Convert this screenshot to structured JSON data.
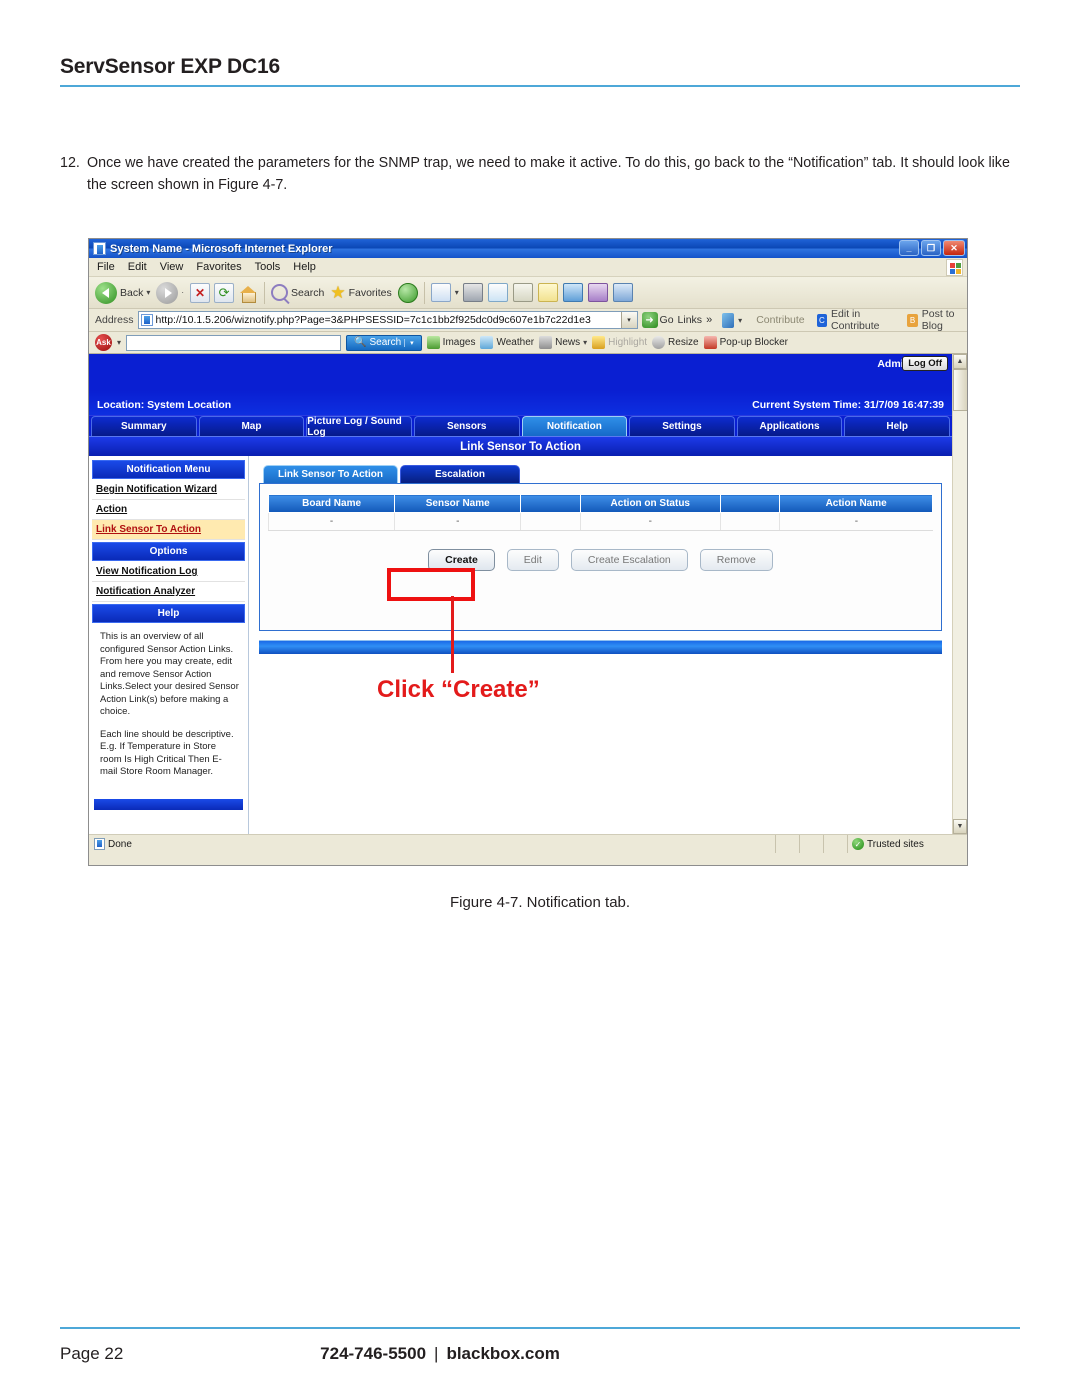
{
  "page": {
    "header_title": "ServSensor EXP DC16",
    "step_number": "12.",
    "step_text": "Once we have created the parameters for the SNMP trap, we need to make it active. To do this, go back to the “Notification” tab. It should look like the screen shown in  Figure 4-7.",
    "figure_caption": "Figure 4-7. Notification tab.",
    "page_number": "Page 22",
    "phone": "724-746-5500",
    "separator": "|",
    "website": "blackbox.com",
    "accent_color": "#4da8d8"
  },
  "browser": {
    "title": "System Name - Microsoft Internet Explorer",
    "window_buttons": {
      "minimize": "_",
      "maximize": "❐",
      "close": "✕"
    },
    "menu": [
      "File",
      "Edit",
      "View",
      "Favorites",
      "Tools",
      "Help"
    ],
    "toolbar": {
      "back_label": "Back",
      "back_caret": "▾",
      "search_label": "Search",
      "favorites_label": "Favorites",
      "icons": [
        "back-icon",
        "forward-icon",
        "stop-icon",
        "refresh-icon",
        "home-icon",
        "search-icon",
        "favorites-icon",
        "history-icon",
        "mail-icon",
        "print-icon",
        "edit-icon",
        "discuss-icon",
        "notes-icon",
        "msn-icon",
        "media-icon",
        "messenger-icon"
      ]
    },
    "address": {
      "label": "Address",
      "url": "http://10.1.5.206/wiznotify.php?Page=3&PHPSESSID=7c1c1bb2f925dc0d9c607e1b7c22d1e3",
      "go_label": "Go",
      "go_arrow": "➜",
      "links_label": "Links",
      "chevrons": "»",
      "contribute_label": "Contribute",
      "edit_in_contribute_label": "Edit in Contribute",
      "post_to_blog_label": "Post to Blog"
    },
    "ask_toolbar": {
      "logo": "Ask",
      "query": "",
      "search_label": "Search",
      "items": [
        "Images",
        "Weather",
        "News",
        "Highlight",
        "Resize",
        "Pop-up Blocker"
      ]
    },
    "status": {
      "done_label": "Done",
      "zone_label": "Trusted sites"
    }
  },
  "app": {
    "admin_label": "Admin",
    "logoff_label": "Log Off",
    "location_label": "Location: System Location",
    "system_time_label": "Current System Time: 31/7/09 16:47:39",
    "main_tabs": [
      {
        "label": "Summary",
        "active": false
      },
      {
        "label": "Map",
        "active": false
      },
      {
        "label": "Picture Log / Sound Log",
        "active": false
      },
      {
        "label": "Sensors",
        "active": false
      },
      {
        "label": "Notification",
        "active": true
      },
      {
        "label": "Settings",
        "active": false
      },
      {
        "label": "Applications",
        "active": false
      },
      {
        "label": "Help",
        "active": false
      }
    ],
    "page_subtitle": "Link Sensor To Action",
    "sidebar": {
      "menu_header": "Notification Menu",
      "menu_items": [
        {
          "label": "Begin Notification Wizard",
          "highlighted": false
        },
        {
          "label": "Action",
          "highlighted": false
        },
        {
          "label": "Link Sensor To Action",
          "highlighted": true
        }
      ],
      "options_header": "Options",
      "options_items": [
        {
          "label": "View Notification Log",
          "highlighted": false
        },
        {
          "label": "Notification Analyzer",
          "highlighted": false
        }
      ],
      "help_header": "Help",
      "help_paragraphs": [
        "This is an overview of all configured Sensor Action Links. From here you may create, edit and remove Sensor Action Links.Select your desired Sensor Action Link(s) before making a choice.",
        "Each line should be descriptive. E.g. If Temperature in Store room Is High Critical Then E-mail Store Room Manager."
      ]
    },
    "sub_tabs": [
      {
        "label": "Link Sensor To Action",
        "active": true
      },
      {
        "label": "Escalation",
        "active": false
      }
    ],
    "table": {
      "columns": [
        "Board Name",
        "Sensor Name",
        "",
        "Action on Status",
        "",
        "Action Name"
      ],
      "rows": [
        [
          "-",
          "-",
          "",
          "-",
          "",
          "-"
        ]
      ]
    },
    "buttons": [
      {
        "label": "Create",
        "enabled": true
      },
      {
        "label": "Edit",
        "enabled": false
      },
      {
        "label": "Create Escalation",
        "enabled": false
      },
      {
        "label": "Remove",
        "enabled": false
      }
    ]
  },
  "annotation": {
    "text": "Click “Create”",
    "color": "#e31b1b"
  }
}
